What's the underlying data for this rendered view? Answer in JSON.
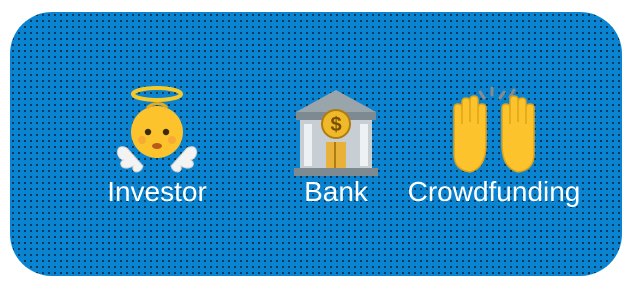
{
  "items": [
    {
      "label": "Investor",
      "icon": "angel-baby-icon"
    },
    {
      "label": "Bank",
      "icon": "bank-building-icon"
    },
    {
      "label": "Crowdfunding",
      "icon": "raised-hands-icon"
    }
  ],
  "colors": {
    "panel_blue": "#0a84d0",
    "dot": "#000000",
    "label_text": "#ffffff"
  }
}
